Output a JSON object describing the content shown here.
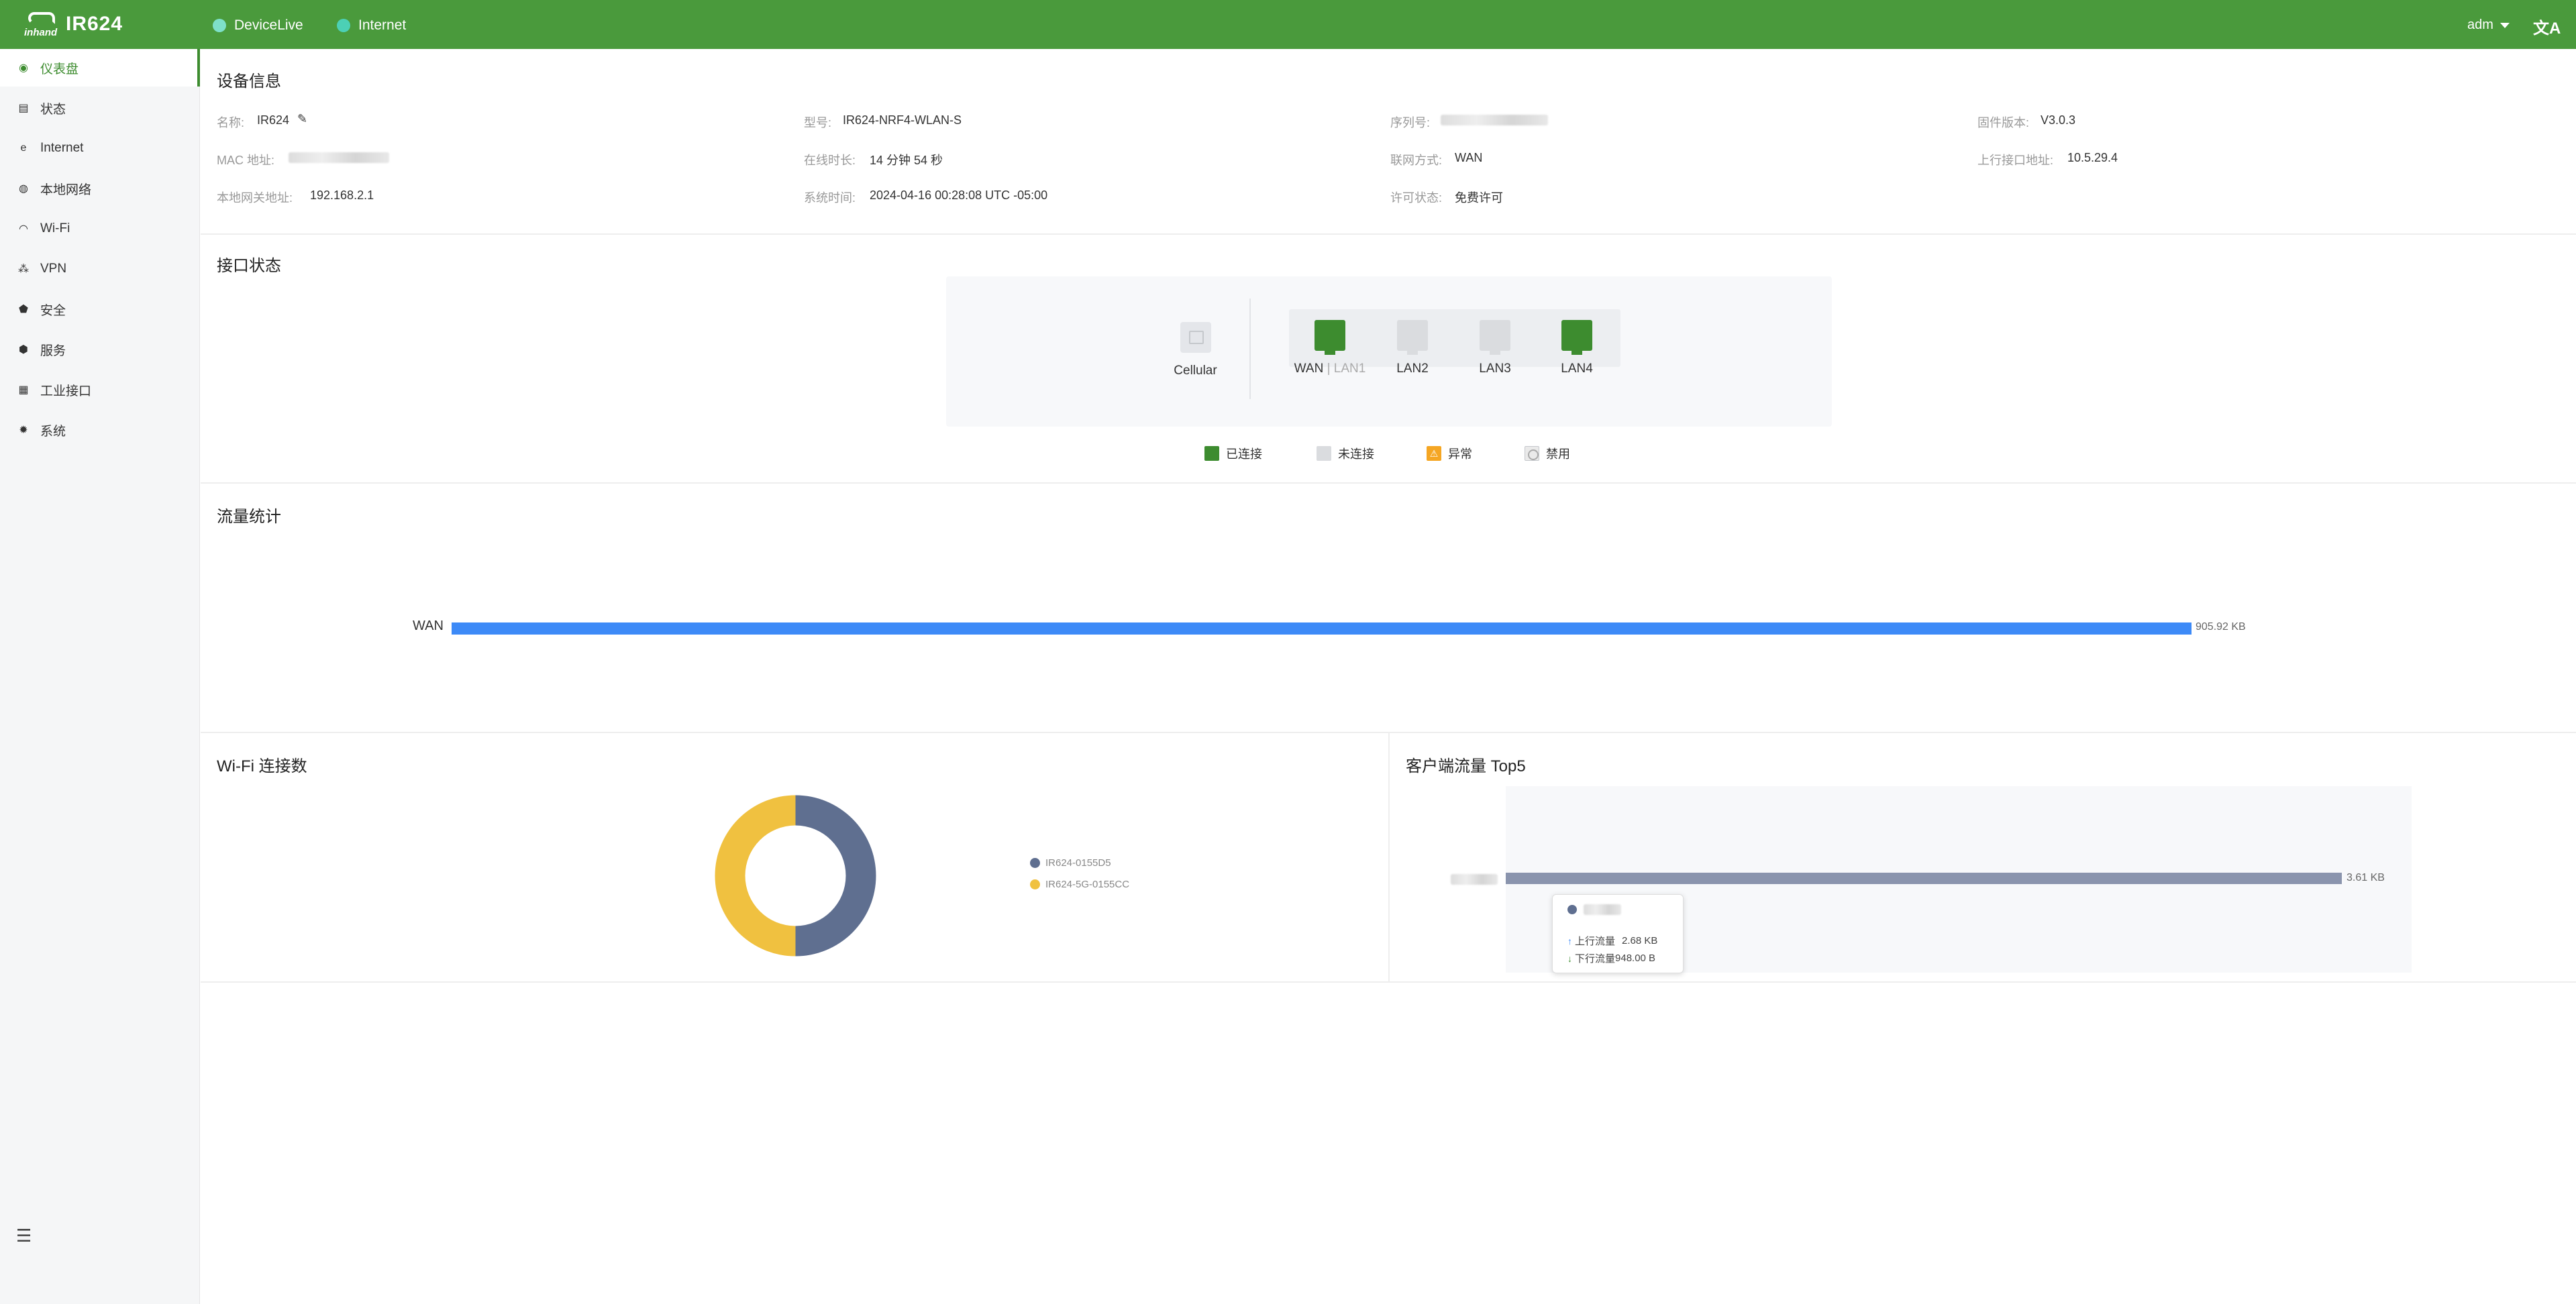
{
  "header": {
    "logo_brand": "inhand",
    "title": "IR624",
    "links": [
      {
        "label": "DeviceLive",
        "color": "#7ee0c9"
      },
      {
        "label": "Internet",
        "color": "#4cd0b5"
      }
    ],
    "user": "adm",
    "lang_icon": "文A"
  },
  "sidebar": {
    "items": [
      {
        "label": "仪表盘",
        "icon": "dashboard-icon",
        "active": true
      },
      {
        "label": "状态",
        "icon": "status-icon"
      },
      {
        "label": "Internet",
        "icon": "internet-icon"
      },
      {
        "label": "本地网络",
        "icon": "local-network-icon"
      },
      {
        "label": "Wi-Fi",
        "icon": "wifi-icon"
      },
      {
        "label": "VPN",
        "icon": "vpn-icon"
      },
      {
        "label": "安全",
        "icon": "security-icon"
      },
      {
        "label": "服务",
        "icon": "service-icon"
      },
      {
        "label": "工业接口",
        "icon": "industrial-interface-icon"
      },
      {
        "label": "系统",
        "icon": "system-icon"
      }
    ]
  },
  "device_info": {
    "title": "设备信息",
    "name_label": "名称:",
    "name_value": "IR624",
    "model_label": "型号:",
    "model_value": "IR624-NRF4-WLAN-S",
    "serial_label": "序列号:",
    "firmware_label": "固件版本:",
    "firmware_value": "V3.0.3",
    "mac_label": "MAC 地址:",
    "uptime_label": "在线时长:",
    "uptime_value": "14 分钟 54 秒",
    "network_mode_label": "联网方式:",
    "network_mode_value": "WAN",
    "uplink_ip_label": "上行接口地址:",
    "uplink_ip_value": "10.5.29.4",
    "gateway_label": "本地网关地址:",
    "gateway_value": "192.168.2.1",
    "systime_label": "系统时间:",
    "systime_value": "2024-04-16 00:28:08 UTC -05:00",
    "license_label": "许可状态:",
    "license_value": "免费许可"
  },
  "interface_status": {
    "title": "接口状态",
    "cellular_label": "Cellular",
    "ports": [
      {
        "name": "WAN",
        "alt": "LAN1",
        "connected": true
      },
      {
        "name": "LAN2",
        "connected": false
      },
      {
        "name": "LAN3",
        "connected": false
      },
      {
        "name": "LAN4",
        "connected": true
      }
    ],
    "wan_sep": "|",
    "legend": {
      "connected": "已连接",
      "disconnected": "未连接",
      "abnormal": "异常",
      "disabled": "禁用",
      "warn_glyph": "⚠"
    },
    "colors": {
      "connected": "#3d8c2f",
      "disconnected": "#dadcdf",
      "abnormal": "#f5a623"
    }
  },
  "traffic": {
    "title": "流量统计",
    "chart_data": {
      "type": "bar",
      "categories": [
        "WAN"
      ],
      "values": [
        905.92
      ],
      "value_labels": [
        "905.92 KB"
      ],
      "color": "#3d8af7"
    }
  },
  "wifi": {
    "title": "Wi-Fi 连接数",
    "chart_data": {
      "type": "pie",
      "series": [
        {
          "name": "IR624-0155D5",
          "value": 1,
          "color": "#5f6f90"
        },
        {
          "name": "IR624-5G-0155CC",
          "value": 1,
          "color": "#f0c140"
        }
      ]
    }
  },
  "top5": {
    "title": "客户端流量 Top5",
    "chart_data": {
      "type": "bar",
      "values": [
        3.61
      ],
      "value_labels": [
        "3.61 KB"
      ],
      "color": "#8a94ad"
    },
    "tooltip": {
      "up_label": "上行流量",
      "up_value": "2.68 KB",
      "down_label": "下行流量",
      "down_value": "948.00 B",
      "up_arrow": "↑",
      "down_arrow": "↓"
    }
  },
  "collapse_icon": "☰"
}
